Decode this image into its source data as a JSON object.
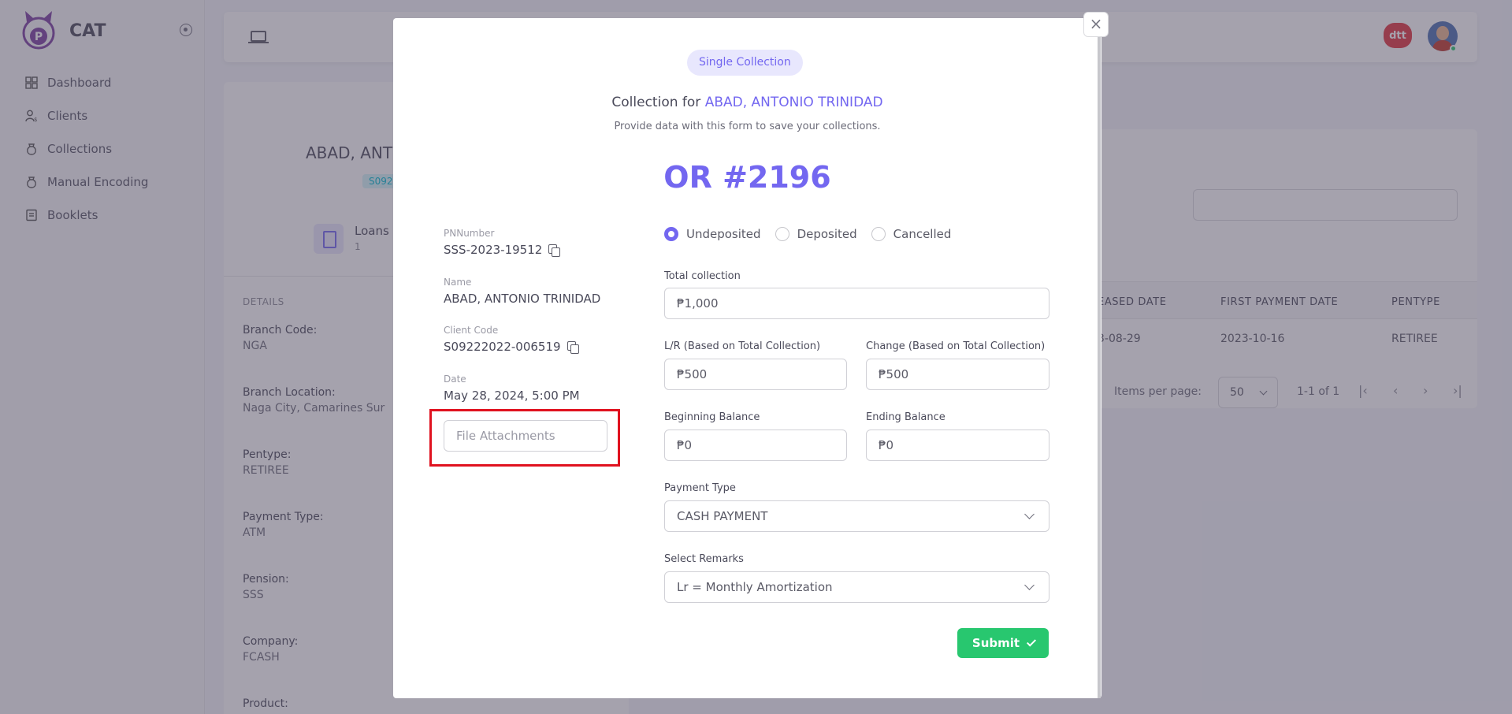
{
  "app": {
    "name": "CAT"
  },
  "sidebar": {
    "items": [
      {
        "label": "Dashboard",
        "icon": "dashboard-icon"
      },
      {
        "label": "Clients",
        "icon": "clients-icon"
      },
      {
        "label": "Collections",
        "icon": "collections-icon"
      },
      {
        "label": "Manual Encoding",
        "icon": "manual-encoding-icon"
      },
      {
        "label": "Booklets",
        "icon": "booklets-icon"
      }
    ]
  },
  "topbar": {
    "partner_logo": "dtt"
  },
  "profile": {
    "name_partial": "ABAD, ANT",
    "code_partial": "S092",
    "loans_label": "Loans",
    "loans_count": "1",
    "details_heading": "DETAILS",
    "details": [
      {
        "key": "Branch Code:",
        "value": "NGA"
      },
      {
        "key": "Branch Location:",
        "value": "Naga City, Camarines Sur"
      },
      {
        "key": "Pentype:",
        "value": "RETIREE"
      },
      {
        "key": "Payment Type:",
        "value": "ATM"
      },
      {
        "key": "Pension:",
        "value": "SSS"
      },
      {
        "key": "Company:",
        "value": "FCASH"
      },
      {
        "key": "Product:",
        "value": ""
      }
    ]
  },
  "loans_table": {
    "headers": [
      "EASED DATE",
      "FIRST PAYMENT DATE",
      "PENTYPE"
    ],
    "row": [
      "3-08-29",
      "2023-10-16",
      "RETIREE"
    ],
    "items_per_page_label": "Items per page:",
    "items_per_page": "50",
    "range": "1-1 of 1"
  },
  "modal": {
    "chip": "Single Collection",
    "title_prefix": "Collection for",
    "client_name": "ABAD, ANTONIO TRINIDAD",
    "subtitle": "Provide data with this form to save your collections.",
    "or_number": "OR #2196",
    "info": {
      "pn_label": "PNNumber",
      "pn_value": "SSS-2023-19512",
      "name_label": "Name",
      "name_value": "ABAD, ANTONIO TRINIDAD",
      "client_code_label": "Client Code",
      "client_code_value": "S09222022-006519",
      "date_label": "Date",
      "date_value": "May 28, 2024, 5:00 PM"
    },
    "file_attachments_placeholder": "File Attachments",
    "status_options": [
      "Undeposited",
      "Deposited",
      "Cancelled"
    ],
    "status_selected": "Undeposited",
    "form": {
      "total_collection_label": "Total collection",
      "total_collection_value": "₱1,000",
      "lr_label": "L/R (Based on Total Collection)",
      "lr_value": "₱500",
      "change_label": "Change (Based on Total Collection)",
      "change_value": "₱500",
      "beginning_balance_label": "Beginning Balance",
      "beginning_balance_value": "₱0",
      "ending_balance_label": "Ending Balance",
      "ending_balance_value": "₱0",
      "payment_type_label": "Payment Type",
      "payment_type_value": "CASH PAYMENT",
      "remarks_label": "Select Remarks",
      "remarks_value": "Lr = Monthly Amortization"
    },
    "submit_label": "Submit"
  },
  "colors": {
    "primary": "#7367f0",
    "success": "#28c76f",
    "highlight": "#e0121f"
  }
}
